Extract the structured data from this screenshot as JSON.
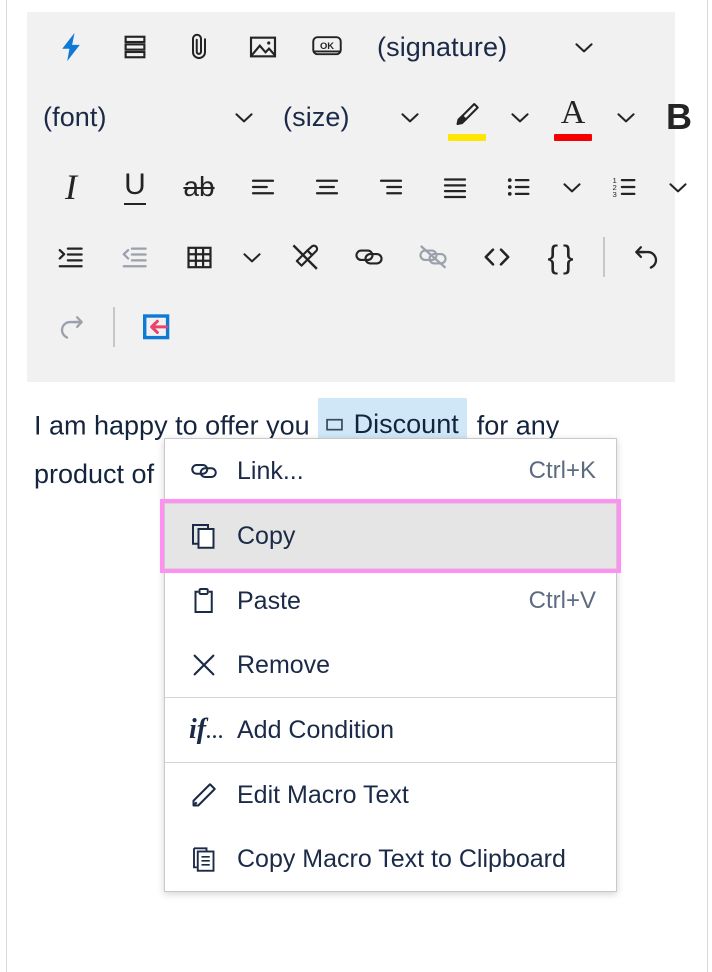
{
  "toolbar": {
    "rows": [
      {
        "id": "row-1",
        "items": [
          {
            "kind": "icon",
            "name": "quick-parts-lightning-icon",
            "label": "Quick Parts"
          },
          {
            "kind": "icon",
            "name": "paragraph-blocks-icon",
            "label": "Paragraph"
          },
          {
            "kind": "icon",
            "name": "attachment-paperclip-icon",
            "label": "Attach file"
          },
          {
            "kind": "icon",
            "name": "insert-image-icon",
            "label": "Insert image"
          },
          {
            "kind": "icon",
            "name": "ok-button-icon",
            "label": "OK button"
          },
          {
            "kind": "text",
            "name": "signature-dropdown-label",
            "label": "(signature)"
          },
          {
            "kind": "chevron",
            "name": "signature-dropdown-chevron",
            "label": "Open signature list"
          }
        ]
      },
      {
        "id": "row-2",
        "items": [
          {
            "kind": "text",
            "name": "font-dropdown-label",
            "label": "(font)"
          },
          {
            "kind": "chevron",
            "name": "font-dropdown-chevron",
            "label": "Open font list"
          },
          {
            "kind": "text",
            "name": "size-dropdown-label",
            "label": "(size)"
          },
          {
            "kind": "chevron",
            "name": "size-dropdown-chevron",
            "label": "Open size list"
          },
          {
            "kind": "icon",
            "name": "highlight-color-icon",
            "label": "Text highlight color"
          },
          {
            "kind": "chevron",
            "name": "highlight-color-chevron",
            "label": "Open highlight colors"
          },
          {
            "kind": "icon",
            "name": "font-color-icon",
            "label": "Font color"
          },
          {
            "kind": "chevron",
            "name": "font-color-chevron",
            "label": "Open font colors"
          },
          {
            "kind": "icon",
            "name": "bold-icon",
            "label": "Bold"
          }
        ]
      },
      {
        "id": "row-3",
        "items": [
          {
            "kind": "icon",
            "name": "italic-icon",
            "label": "Italic"
          },
          {
            "kind": "icon",
            "name": "underline-icon",
            "label": "Underline"
          },
          {
            "kind": "icon",
            "name": "strikethrough-icon",
            "label": "Strikethrough"
          },
          {
            "kind": "icon",
            "name": "align-left-icon",
            "label": "Align left"
          },
          {
            "kind": "icon",
            "name": "align-center-icon",
            "label": "Align center"
          },
          {
            "kind": "icon",
            "name": "align-right-icon",
            "label": "Align right"
          },
          {
            "kind": "icon",
            "name": "align-justify-icon",
            "label": "Justify"
          },
          {
            "kind": "icon",
            "name": "bulleted-list-icon",
            "label": "Bulleted list"
          },
          {
            "kind": "chevron",
            "name": "bulleted-list-chevron",
            "label": "Bullet styles"
          },
          {
            "kind": "icon",
            "name": "numbered-list-icon",
            "label": "Numbered list"
          },
          {
            "kind": "chevron",
            "name": "numbered-list-chevron",
            "label": "Number styles"
          }
        ]
      },
      {
        "id": "row-4",
        "items": [
          {
            "kind": "icon",
            "name": "increase-indent-icon",
            "label": "Increase indent"
          },
          {
            "kind": "icon",
            "name": "decrease-indent-icon",
            "label": "Decrease indent",
            "disabled": true
          },
          {
            "kind": "icon",
            "name": "insert-table-icon",
            "label": "Insert table"
          },
          {
            "kind": "chevron",
            "name": "insert-table-chevron",
            "label": "Table options"
          },
          {
            "kind": "icon",
            "name": "clear-formatting-icon",
            "label": "Clear formatting"
          },
          {
            "kind": "icon",
            "name": "insert-link-icon",
            "label": "Insert link"
          },
          {
            "kind": "icon",
            "name": "remove-link-icon",
            "label": "Remove link",
            "disabled": true
          },
          {
            "kind": "icon",
            "name": "source-code-icon",
            "label": "Source code"
          },
          {
            "kind": "icon",
            "name": "macro-braces-icon",
            "label": "Insert macro"
          },
          {
            "kind": "separator",
            "name": "toolbar-separator"
          },
          {
            "kind": "icon",
            "name": "undo-icon",
            "label": "Undo"
          }
        ]
      },
      {
        "id": "row-5",
        "items": [
          {
            "kind": "icon",
            "name": "redo-icon",
            "label": "Redo",
            "disabled": true
          },
          {
            "kind": "separator",
            "name": "toolbar-separator-2"
          },
          {
            "kind": "icon",
            "name": "insert-macro-field-icon",
            "label": "Insert macro field"
          }
        ]
      }
    ]
  },
  "document": {
    "line1_before": "I am happy to offer you",
    "macro_chip": "Discount",
    "line1_after": "for any",
    "line2": "product of"
  },
  "menu": {
    "groups": [
      {
        "items": [
          {
            "icon": "link-icon",
            "label": "Link...",
            "accel": "Ctrl+K",
            "selected": false
          }
        ]
      },
      {
        "items": [
          {
            "icon": "copy-icon",
            "label": "Copy",
            "accel": "",
            "selected": true,
            "highlighted": true
          }
        ]
      },
      {
        "items": [
          {
            "icon": "paste-icon",
            "label": "Paste",
            "accel": "Ctrl+V",
            "selected": false
          },
          {
            "icon": "remove-x-icon",
            "label": "Remove",
            "accel": "",
            "selected": false
          }
        ]
      },
      {
        "items": [
          {
            "icon": "if-condition-icon",
            "label": "Add Condition",
            "accel": "",
            "selected": false
          }
        ]
      },
      {
        "items": [
          {
            "icon": "pencil-edit-icon",
            "label": "Edit Macro Text",
            "accel": "",
            "selected": false
          },
          {
            "icon": "copy-document-icon",
            "label": "Copy Macro Text to Clipboard",
            "accel": "",
            "selected": false
          }
        ]
      }
    ]
  },
  "colors": {
    "accent_blue": "#0f7ad6",
    "highlight_yellow": "#ffe600",
    "font_color_red": "#f40000",
    "macro_chip_bg": "#cfe7f7",
    "annotation_pink": "#ff8ff0",
    "toolbar_bg": "#f1f1f1",
    "text_navy": "#1b2a47"
  }
}
